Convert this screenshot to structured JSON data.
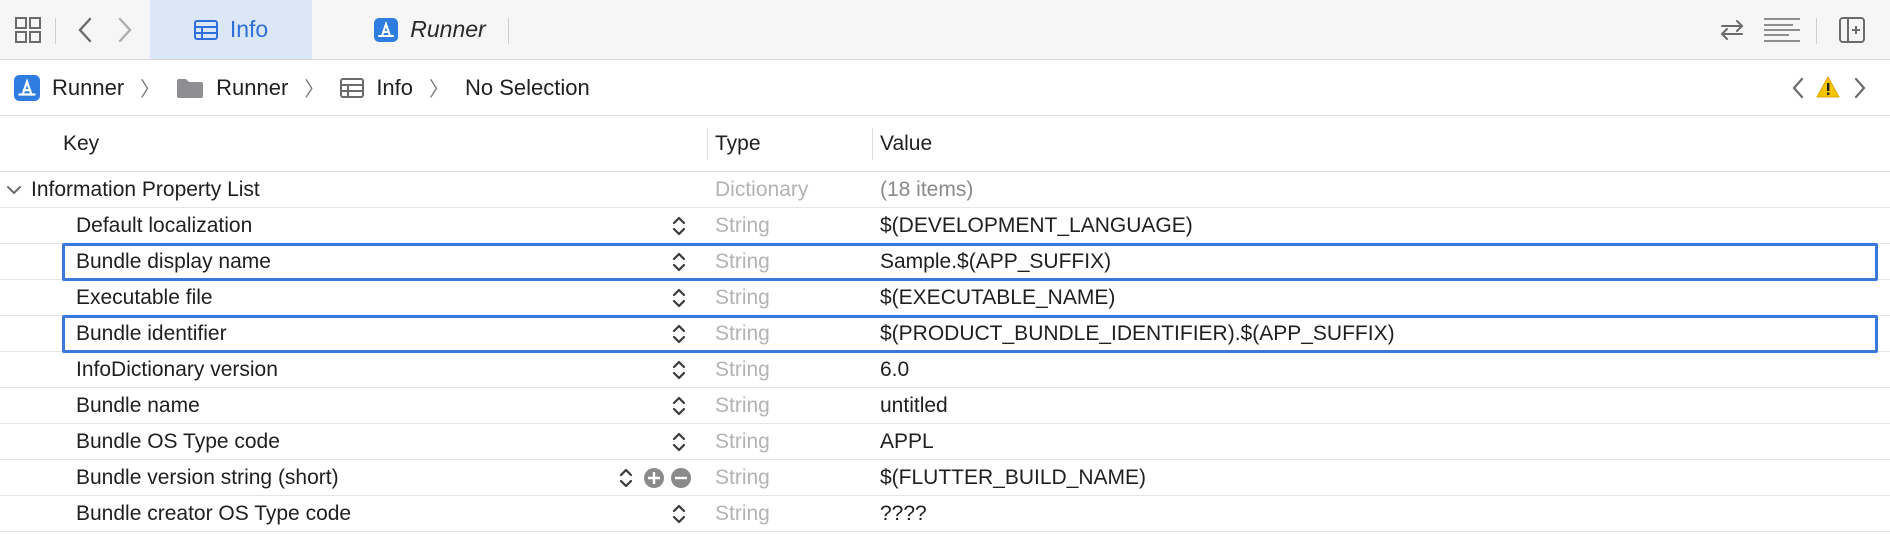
{
  "tabs": [
    {
      "label": "Info",
      "icon": "table-icon",
      "active": true
    },
    {
      "label": "Runner",
      "icon": "app-store-icon",
      "active": false
    }
  ],
  "breadcrumb": [
    {
      "label": "Runner",
      "icon": "app-store-icon"
    },
    {
      "label": "Runner",
      "icon": "folder-icon"
    },
    {
      "label": "Info",
      "icon": "table-icon"
    },
    {
      "label": "No Selection",
      "icon": ""
    }
  ],
  "columns": {
    "key": "Key",
    "type": "Type",
    "value": "Value"
  },
  "root": {
    "key": "Information Property List",
    "type": "Dictionary",
    "value": "(18 items)"
  },
  "rows": [
    {
      "key": "Default localization",
      "type": "String",
      "value": "$(DEVELOPMENT_LANGUAGE)",
      "highlighted": false
    },
    {
      "key": "Bundle display name",
      "type": "String",
      "value": "Sample.$(APP_SUFFIX)",
      "highlighted": true
    },
    {
      "key": "Executable file",
      "type": "String",
      "value": "$(EXECUTABLE_NAME)",
      "highlighted": false
    },
    {
      "key": "Bundle identifier",
      "type": "String",
      "value": "$(PRODUCT_BUNDLE_IDENTIFIER).$(APP_SUFFIX)",
      "highlighted": true
    },
    {
      "key": "InfoDictionary version",
      "type": "String",
      "value": "6.0",
      "highlighted": false
    },
    {
      "key": "Bundle name",
      "type": "String",
      "value": "untitled",
      "highlighted": false
    },
    {
      "key": "Bundle OS Type code",
      "type": "String",
      "value": "APPL",
      "highlighted": false
    },
    {
      "key": "Bundle version string (short)",
      "type": "String",
      "value": "$(FLUTTER_BUILD_NAME)",
      "highlighted": false,
      "hovered": true
    },
    {
      "key": "Bundle creator OS Type code",
      "type": "String",
      "value": "????",
      "highlighted": false
    }
  ],
  "colors": {
    "accent": "#2f6fdc",
    "highlight_border": "#3b78dc",
    "warning": "#f5c400"
  }
}
